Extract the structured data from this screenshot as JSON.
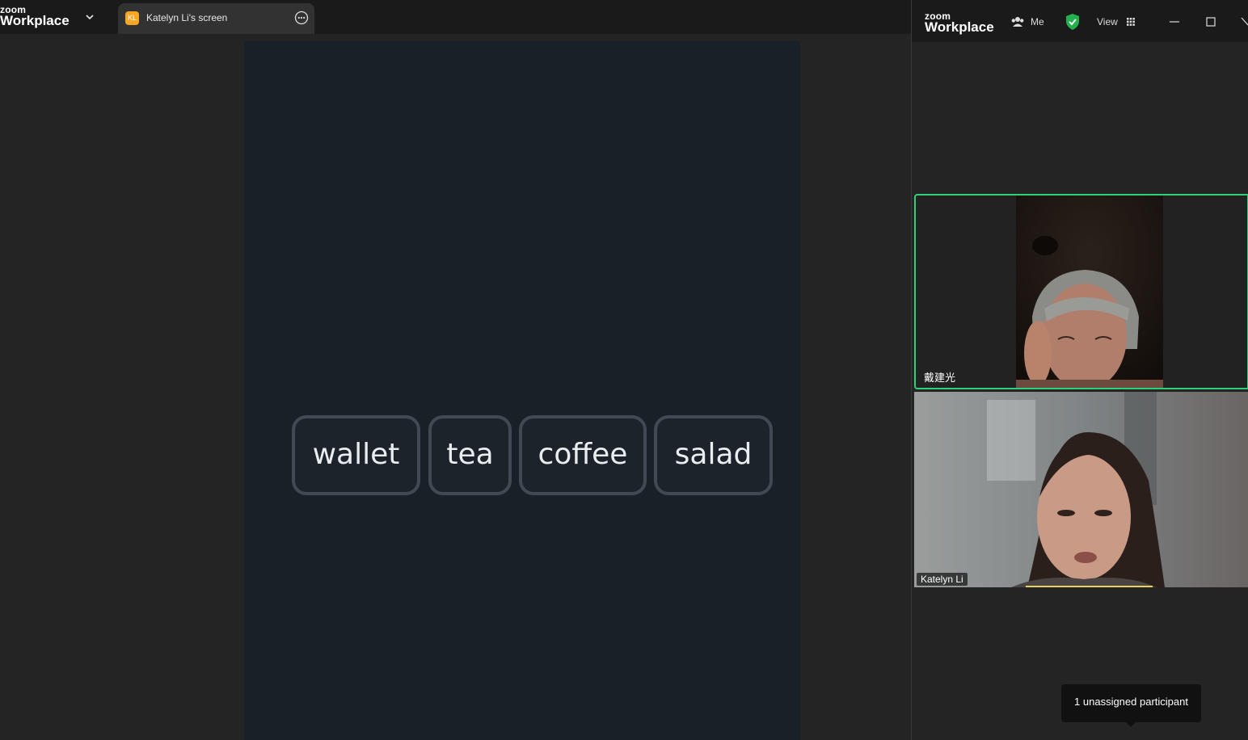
{
  "main": {
    "logo_small": "zoom",
    "logo_big": "Workplace",
    "tab": {
      "avatar_initials": "KL",
      "label": "Katelyn Li's screen"
    },
    "shared_words": [
      "wallet",
      "tea",
      "coffee",
      "salad"
    ]
  },
  "side": {
    "logo_small": "zoom",
    "logo_big": "Workplace",
    "meeting_label": "Me",
    "view_label": "View",
    "participants": [
      {
        "name": "戴建光",
        "active_speaker": true
      },
      {
        "name": "Katelyn Li",
        "active_speaker": false
      }
    ],
    "tooltip": "1 unassigned participant"
  },
  "colors": {
    "accent_green": "#2fd07a",
    "avatar_orange": "#f5a623",
    "shield_green": "#22b14c"
  }
}
